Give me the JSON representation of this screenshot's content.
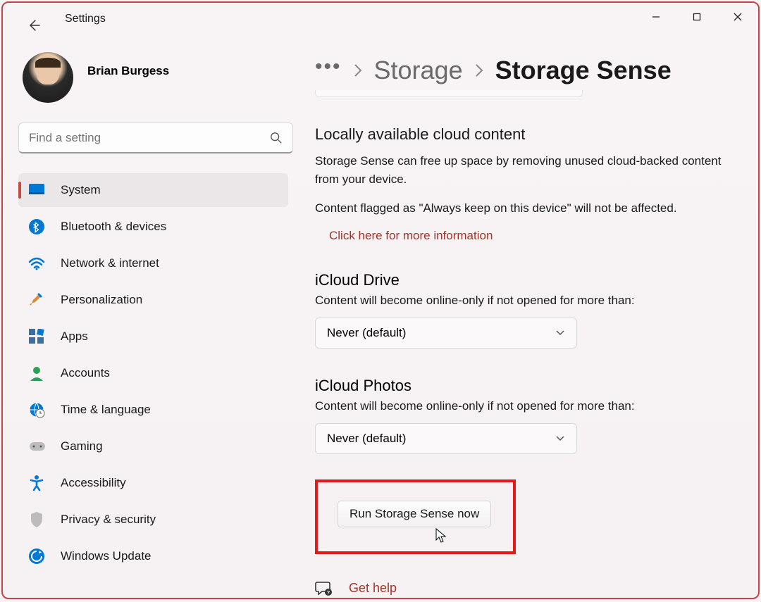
{
  "app_title": "Settings",
  "profile": {
    "name": "Brian Burgess"
  },
  "search": {
    "placeholder": "Find a setting"
  },
  "nav": {
    "items": [
      {
        "label": "System"
      },
      {
        "label": "Bluetooth & devices"
      },
      {
        "label": "Network & internet"
      },
      {
        "label": "Personalization"
      },
      {
        "label": "Apps"
      },
      {
        "label": "Accounts"
      },
      {
        "label": "Time & language"
      },
      {
        "label": "Gaming"
      },
      {
        "label": "Accessibility"
      },
      {
        "label": "Privacy & security"
      },
      {
        "label": "Windows Update"
      }
    ]
  },
  "breadcrumb": {
    "parent": "Storage",
    "current": "Storage Sense"
  },
  "cloud": {
    "heading": "Locally available cloud content",
    "desc1": "Storage Sense can free up space by removing unused cloud-backed content from your device.",
    "desc2": "Content flagged as \"Always keep on this device\" will not be affected.",
    "link": "Click here for more information"
  },
  "icloud_drive": {
    "heading": "iCloud Drive",
    "desc": "Content will become online-only if not opened for more than:",
    "value": "Never (default)"
  },
  "icloud_photos": {
    "heading": "iCloud Photos",
    "desc": "Content will become online-only if not opened for more than:",
    "value": "Never (default)"
  },
  "run_button": "Run Storage Sense now",
  "help": {
    "label": "Get help"
  }
}
